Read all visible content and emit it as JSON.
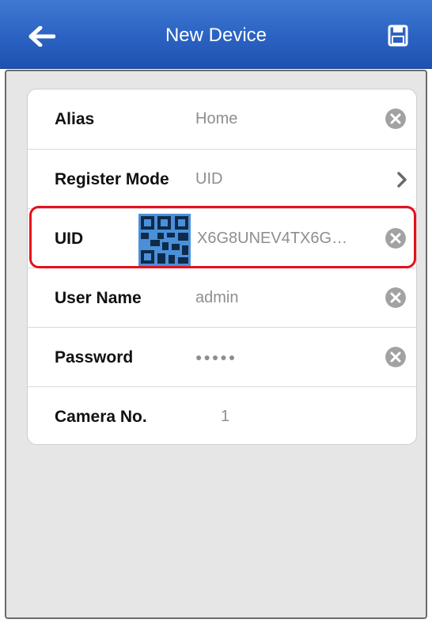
{
  "header": {
    "title": "New Device"
  },
  "form": {
    "alias": {
      "label": "Alias",
      "value": "Home"
    },
    "register_mode": {
      "label": "Register Mode",
      "value": "UID"
    },
    "uid": {
      "label": "UID",
      "value": "X6G8UNEV4TX6G…"
    },
    "user_name": {
      "label": "User Name",
      "value": "admin"
    },
    "password": {
      "label": "Password",
      "value": "●●●●●"
    },
    "camera_no": {
      "label": "Camera No.",
      "value": "1"
    }
  },
  "icons": {
    "back": "back-arrow-icon",
    "save": "save-icon",
    "clear": "clear-icon",
    "chevron": "chevron-right-icon",
    "qr": "qr-code-icon"
  },
  "colors": {
    "nav_bar": "#2b62c2",
    "highlight": "#e4101c",
    "qr_accent": "#4a90d9"
  }
}
